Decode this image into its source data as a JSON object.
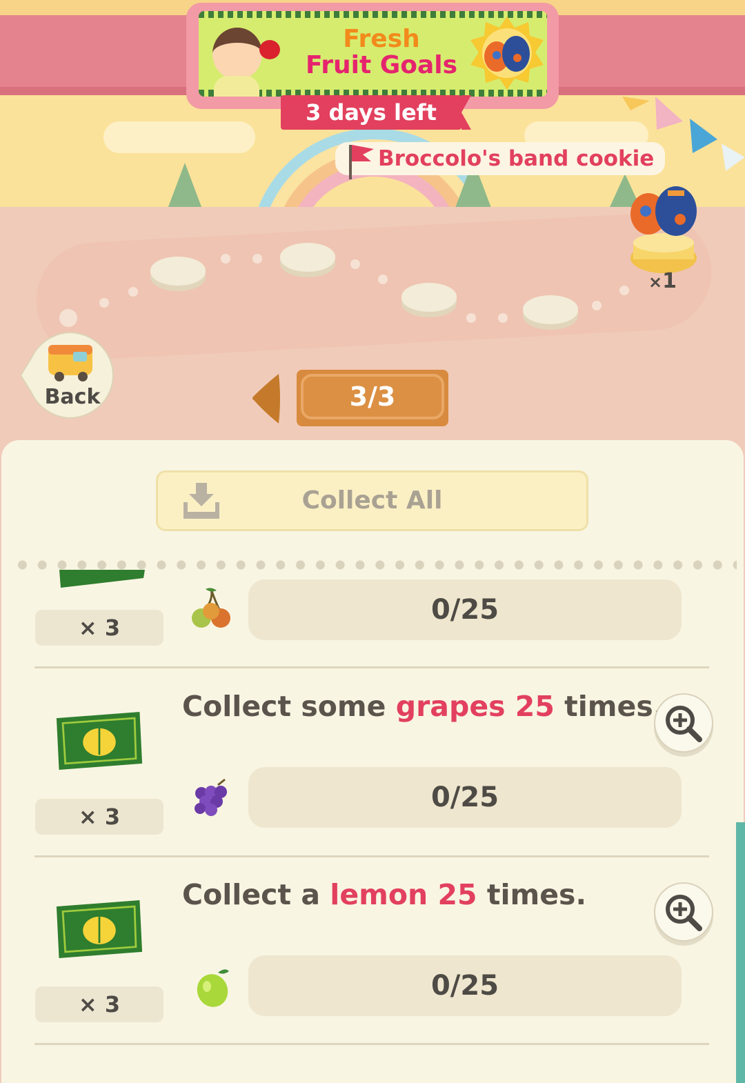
{
  "event": {
    "title_line1": "Fresh",
    "title_line2": "Fruit Goals",
    "time_left": "3 days left",
    "reward_name": "Broccolo's band cookie",
    "reward_count_prefix": "×",
    "reward_count": "1"
  },
  "navigation": {
    "back_label": "Back",
    "page_indicator": "3/3"
  },
  "actions": {
    "collect_all_label": "Collect All"
  },
  "tasks": [
    {
      "description_parts": [],
      "reward_multiplier": "× 3",
      "fruit_icon": "cherries-icon",
      "progress": "0/25"
    },
    {
      "description_parts": [
        "Collect some ",
        "grapes 25",
        " times."
      ],
      "reward_multiplier": "× 3",
      "fruit_icon": "grapes-icon",
      "progress": "0/25"
    },
    {
      "description_parts": [
        "Collect a ",
        "lemon 25",
        " times."
      ],
      "reward_multiplier": "× 3",
      "fruit_icon": "lemon-icon",
      "progress": "0/25"
    }
  ],
  "colors": {
    "accent_pink": "#e2405e",
    "panel_bg": "#f9f5e3",
    "pager_orange": "#d88a3e",
    "leaf_ticket_green": "#2f7d2e"
  }
}
